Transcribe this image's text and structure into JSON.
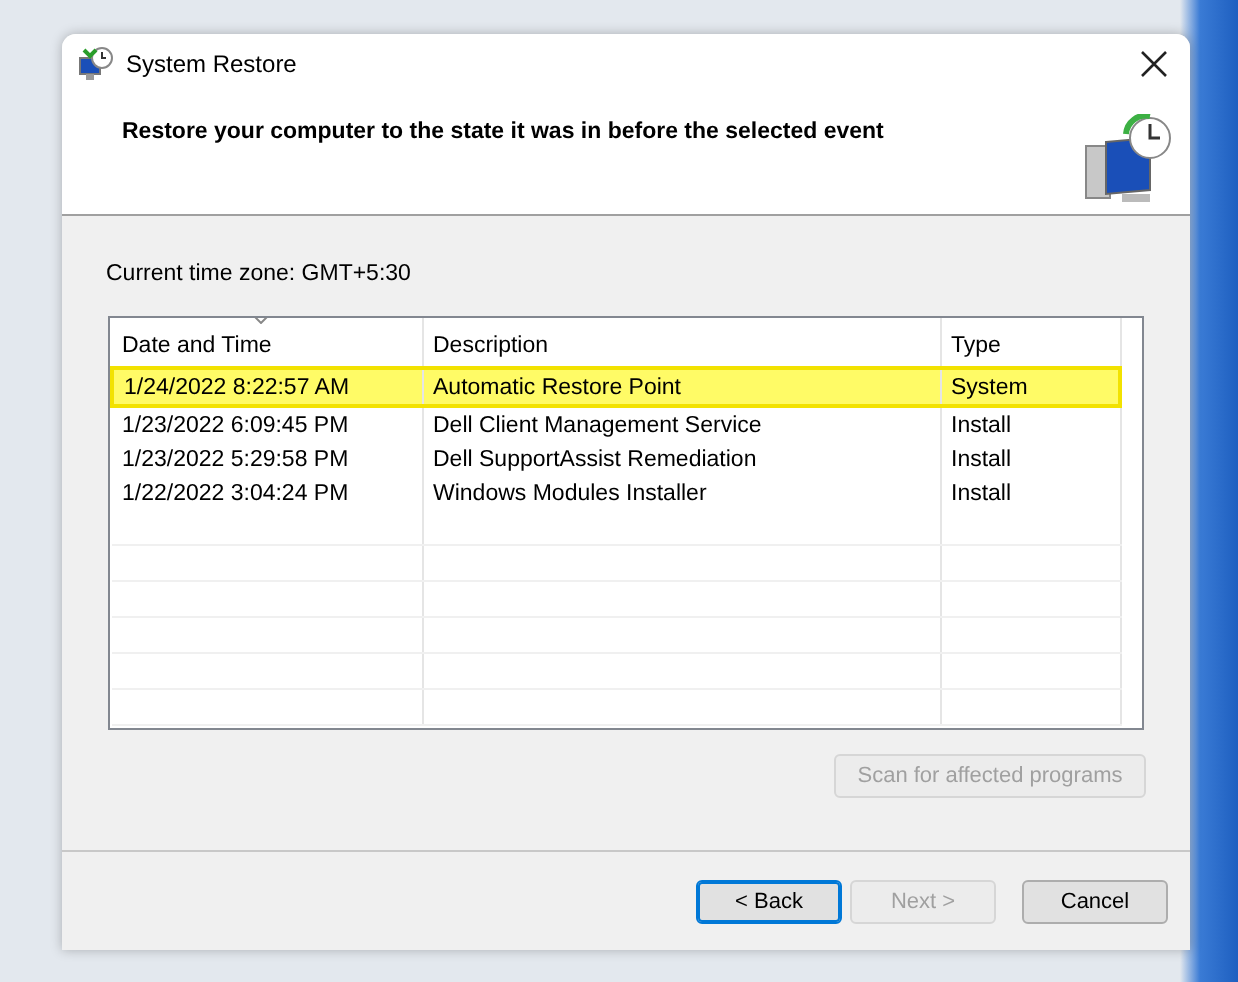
{
  "window": {
    "title": "System Restore"
  },
  "heading": "Restore your computer to the state it was in before the selected event",
  "time_zone": "Current time zone: GMT+5:30",
  "table": {
    "columns": [
      "Date and Time",
      "Description",
      "Type"
    ],
    "rows": [
      {
        "cells": [
          "1/24/2022 8:22:57 AM",
          "Automatic Restore Point",
          "System"
        ],
        "selected": true
      },
      {
        "cells": [
          "1/23/2022 6:09:45 PM",
          "Dell Client Management Service",
          "Install"
        ],
        "selected": false
      },
      {
        "cells": [
          "1/23/2022 5:29:58 PM",
          "Dell SupportAssist Remediation",
          "Install"
        ],
        "selected": false
      },
      {
        "cells": [
          "1/22/2022 3:04:24 PM",
          "Windows Modules Installer",
          "Install"
        ],
        "selected": false
      }
    ]
  },
  "scan_button": {
    "label": "Scan for affected programs",
    "disabled": true
  },
  "buttons": [
    {
      "label": "< Back",
      "disabled": false
    },
    {
      "label": "Next >",
      "disabled": true
    },
    {
      "label": "Cancel",
      "disabled": false
    }
  ]
}
